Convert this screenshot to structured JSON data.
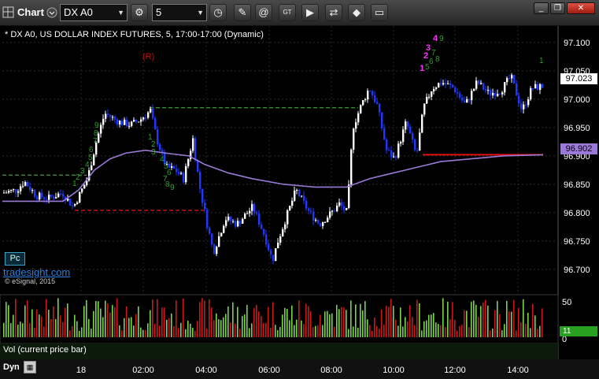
{
  "toolbar": {
    "app_label": "Chart",
    "symbol": "DX A0",
    "interval": "5",
    "icons": [
      "chart-grid-icon",
      "dropdown-chevron-icon",
      "gear-icon",
      "clock-icon",
      "pencil-icon",
      "spiral-icon",
      "ticker-icon",
      "play-icon",
      "arrows-icon",
      "tag-icon",
      "speech-bubble-icon"
    ]
  },
  "chart": {
    "title": "* DX A0, US DOLLAR INDEX FUTURES, 5, 17:00-17:00 (Dynamic)",
    "watermark": "tradesight.com",
    "pc_label": "Pc",
    "copyright": "© eSignal, 2015",
    "r_marker": "(R)",
    "last_price": "97.023",
    "ma_price": "96.902",
    "vol_label": "Vol (current price bar)",
    "vol_current": "11",
    "dyn_label": "Dyn",
    "colors": {
      "up": "#ffffff",
      "down": "#1f38ff",
      "ma": "#9a7ad6",
      "green_line": "#2f8f2f",
      "red_line": "#e01010",
      "vol_up": "#7ad34a",
      "vol_down": "#c81818",
      "magenta": "#ff33ff"
    }
  },
  "chart_data": {
    "type": "candlestick",
    "y_axis": {
      "ticks": [
        "97.100",
        "97.050",
        "97.000",
        "96.950",
        "96.900",
        "96.850",
        "96.800",
        "96.750",
        "96.700"
      ],
      "ylim": [
        96.672,
        97.129
      ]
    },
    "x_axis": {
      "ticks": [
        "18",
        "02:00",
        "04:00",
        "06:00",
        "08:00",
        "10:00",
        "12:00",
        "14:00"
      ]
    },
    "volume_axis": {
      "ticks": [
        "50",
        "0"
      ]
    },
    "annotations": {
      "seq_green_left": [
        "9",
        "8",
        "7",
        "6",
        "5",
        "4",
        "3",
        "2",
        "1"
      ],
      "seq_green_mid": [
        "1",
        "2",
        "3",
        "4",
        "5",
        "6",
        "7",
        "8",
        "9"
      ],
      "seq_magenta": [
        "1",
        "2",
        "3",
        "4"
      ],
      "seq_green_right": [
        "5",
        "6",
        "7",
        "8",
        "9"
      ],
      "right_one": "1"
    },
    "levels": [
      {
        "name": "green-left",
        "value": 96.866,
        "color": "#2f8f2f"
      },
      {
        "name": "green-mid",
        "value": 96.985,
        "color": "#2f8f2f"
      },
      {
        "name": "red-left",
        "value": 96.804,
        "color": "#e01010"
      },
      {
        "name": "red-right",
        "value": 96.902,
        "color": "#e01010"
      }
    ]
  }
}
